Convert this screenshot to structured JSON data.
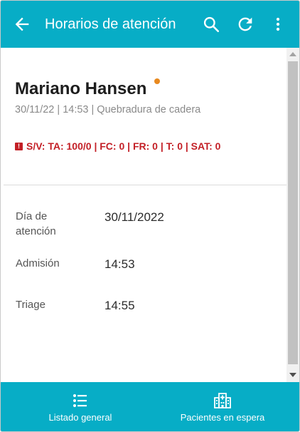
{
  "appbar": {
    "title": "Horarios de atención",
    "icons": [
      "arrow-back-icon",
      "search-icon",
      "refresh-icon",
      "more-vert-icon"
    ],
    "background": "#07adc6"
  },
  "patient": {
    "name": "Mariano Hansen",
    "status_color": "#e8891f",
    "meta": "30/11/22 | 14:53 | Quebradura de cadera",
    "vitals": "S/V: TA: 100/0 | FC: 0 | FR: 0 | T: 0 | SAT: 0",
    "vitals_color": "#c31f26"
  },
  "schedule": {
    "rows": [
      {
        "label": "Día de atención",
        "value": "30/11/2022"
      },
      {
        "label": "Admisión",
        "value": "14:53"
      },
      {
        "label": "Triage",
        "value": "14:55"
      }
    ]
  },
  "bottomnav": {
    "items": [
      {
        "label": "Listado general",
        "icon": "list-icon"
      },
      {
        "label": "Pacientes en espera",
        "icon": "hospital-icon"
      }
    ]
  }
}
